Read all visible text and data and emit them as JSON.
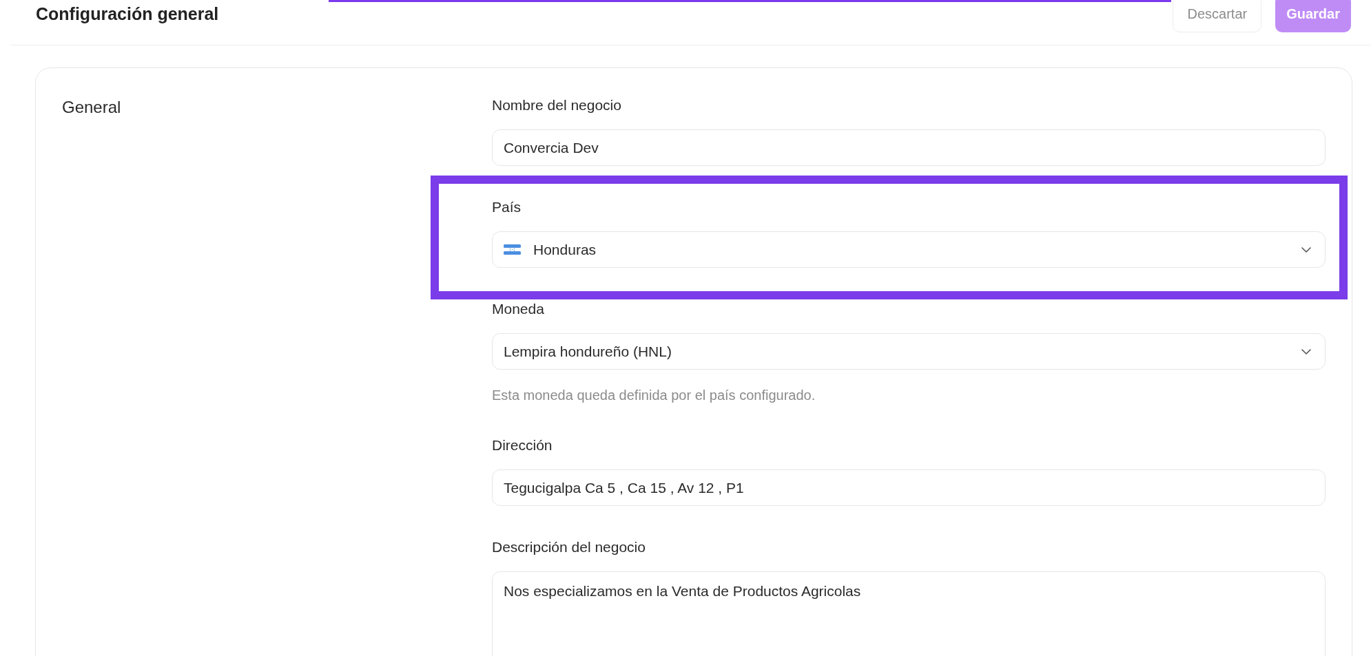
{
  "header": {
    "title": "Configuración general",
    "buttons": [
      {
        "label": "Descartar",
        "kind": "secondary",
        "disabled": true
      },
      {
        "label": "Guardar",
        "kind": "primary",
        "disabled": true
      }
    ]
  },
  "section": {
    "title": "General",
    "fields": [
      {
        "kind": "text",
        "label": "Nombre del negocio",
        "value": "Convercia Dev",
        "highlighted": false
      },
      {
        "kind": "country_select",
        "label": "País",
        "value": "Honduras",
        "highlighted": true
      },
      {
        "kind": "select",
        "label": "Moneda",
        "value": "Lempira hondureño (HNL)",
        "help": "Esta moneda queda definida por el país configurado.",
        "highlighted": false
      },
      {
        "kind": "text",
        "label": "Dirección",
        "value": "Tegucigalpa Ca 5 , Ca 15 , Av 12 , P1",
        "highlighted": false
      },
      {
        "kind": "textarea",
        "label": "Descripción del negocio",
        "value": "Nos especializamos en la Venta de Productos Agricolas",
        "highlighted": false
      }
    ]
  }
}
